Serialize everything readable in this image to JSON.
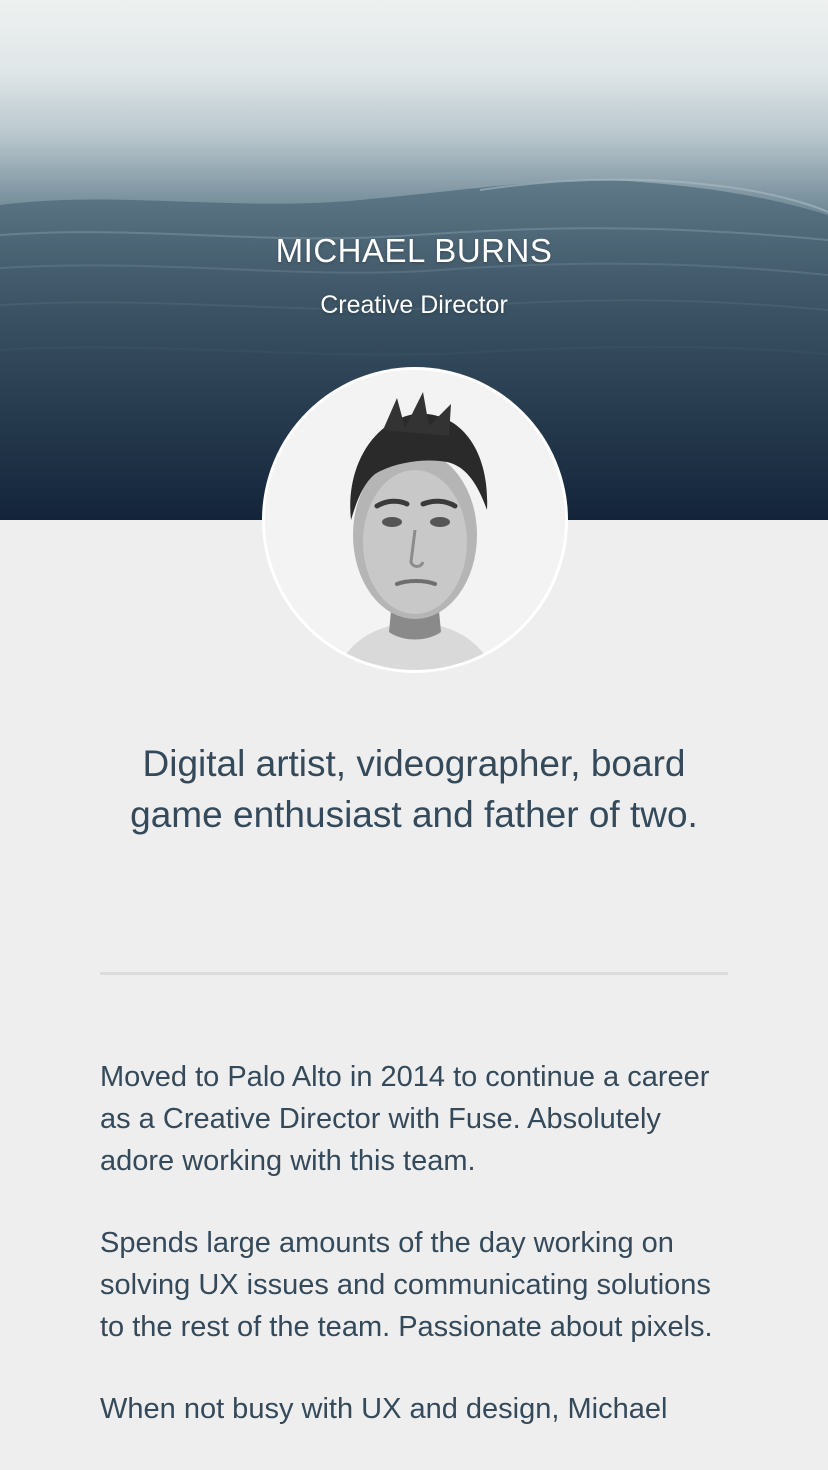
{
  "profile": {
    "name": "MICHAEL BURNS",
    "role": "Creative Director",
    "tagline": "Digital artist, videographer, board game enthusiast and father of two.",
    "bio": [
      "Moved to Palo Alto in 2014 to continue a career as a Creative Director with Fuse. Absolutely adore working with this team.",
      "Spends large amounts of the day working on solving UX issues and communicating solutions to the rest of the team. Passionate about pixels.",
      "When not busy with UX and design, Michael"
    ]
  },
  "colors": {
    "background": "#eeeeee",
    "text": "#34495a",
    "hero_dark": "#152638",
    "divider": "#dcdcdc"
  },
  "icons": {
    "avatar": "profile-photo"
  }
}
